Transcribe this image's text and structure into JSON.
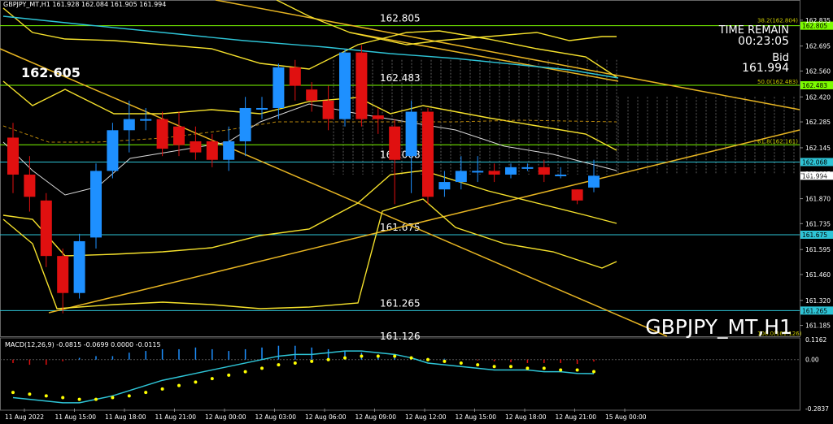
{
  "header": {
    "ohlc": "GBPJPY_MT,H1  161.928 162.084 161.905 161.994"
  },
  "info": {
    "time_remain_label": "TIME REMAIN",
    "time_remain": "00:23:05",
    "bid_label": "Bid",
    "bid": "161.994"
  },
  "symbol_label": "GBPJPY_MT,H1",
  "big_price": "162.605",
  "macd_header": "MACD(12,26,9) -0.0815 -0.0699 0.0000 -0.0115",
  "colors": {
    "bull": "#1e90ff",
    "bear": "#e01010",
    "yellow": "#f5e12c",
    "gold": "#e6b422",
    "cyan": "#2ec4d6",
    "green": "#7cfc00",
    "grid": "#8a8a8a",
    "macd_line": "#2ec4d6",
    "signal": "#ffff00"
  },
  "chart_data": [
    {
      "type": "candlestick",
      "title": "GBPJPY_MT,H1",
      "ylim": [
        161.126,
        162.9
      ],
      "y_ticks": [
        "162.835",
        "162.695",
        "162.560",
        "162.420",
        "162.285",
        "162.145",
        "162.005",
        "161.870",
        "161.735",
        "161.595",
        "161.460",
        "161.320",
        "161.185"
      ],
      "x_ticks": [
        "11 Aug 2022",
        "11 Aug 15:00",
        "11 Aug 18:00",
        "11 Aug 21:00",
        "12 Aug 00:00",
        "12 Aug 03:00",
        "12 Aug 06:00",
        "12 Aug 09:00",
        "12 Aug 12:00",
        "12 Aug 15:00",
        "12 Aug 18:00",
        "12 Aug 21:00",
        "15 Aug 00:00"
      ],
      "candles": [
        {
          "o": 162.2,
          "h": 162.28,
          "c": 162.0,
          "l": 161.9
        },
        {
          "o": 162.0,
          "h": 162.1,
          "c": 161.88,
          "l": 161.8
        },
        {
          "o": 161.86,
          "h": 161.9,
          "c": 161.56,
          "l": 161.5
        },
        {
          "o": 161.56,
          "h": 161.6,
          "c": 161.36,
          "l": 161.25
        },
        {
          "o": 161.36,
          "h": 161.68,
          "c": 161.64,
          "l": 161.33
        },
        {
          "o": 161.66,
          "h": 162.06,
          "c": 162.02,
          "l": 161.6
        },
        {
          "o": 162.02,
          "h": 162.28,
          "c": 162.24,
          "l": 161.98
        },
        {
          "o": 162.24,
          "h": 162.4,
          "c": 162.3,
          "l": 162.12
        },
        {
          "o": 162.3,
          "h": 162.36,
          "c": 162.3,
          "l": 162.24
        },
        {
          "o": 162.3,
          "h": 162.34,
          "c": 162.14,
          "l": 162.1
        },
        {
          "o": 162.26,
          "h": 162.34,
          "c": 162.16,
          "l": 162.1
        },
        {
          "o": 162.18,
          "h": 162.26,
          "c": 162.12,
          "l": 162.08
        },
        {
          "o": 162.18,
          "h": 162.22,
          "c": 162.08,
          "l": 162.04
        },
        {
          "o": 162.08,
          "h": 162.26,
          "c": 162.18,
          "l": 162.02
        },
        {
          "o": 162.18,
          "h": 162.42,
          "c": 162.36,
          "l": 162.1
        },
        {
          "o": 162.36,
          "h": 162.42,
          "c": 162.36,
          "l": 162.3
        },
        {
          "o": 162.36,
          "h": 162.6,
          "c": 162.58,
          "l": 162.3
        },
        {
          "o": 162.58,
          "h": 162.62,
          "c": 162.48,
          "l": 162.4
        },
        {
          "o": 162.46,
          "h": 162.5,
          "c": 162.4,
          "l": 162.34
        },
        {
          "o": 162.4,
          "h": 162.48,
          "c": 162.3,
          "l": 162.24
        },
        {
          "o": 162.3,
          "h": 162.68,
          "c": 162.66,
          "l": 162.26
        },
        {
          "o": 162.66,
          "h": 162.7,
          "c": 162.3,
          "l": 162.26
        },
        {
          "o": 162.32,
          "h": 162.36,
          "c": 162.3,
          "l": 162.22
        },
        {
          "o": 162.26,
          "h": 162.3,
          "c": 162.08,
          "l": 161.84
        },
        {
          "o": 162.1,
          "h": 162.4,
          "c": 162.34,
          "l": 161.9
        },
        {
          "o": 162.34,
          "h": 162.36,
          "c": 161.88,
          "l": 161.84
        },
        {
          "o": 161.92,
          "h": 162.02,
          "c": 161.96,
          "l": 161.88
        },
        {
          "o": 161.96,
          "h": 162.1,
          "c": 162.02,
          "l": 161.92
        },
        {
          "o": 162.02,
          "h": 162.1,
          "c": 162.02,
          "l": 161.96
        },
        {
          "o": 162.02,
          "h": 162.06,
          "c": 162.0,
          "l": 161.96
        },
        {
          "o": 162.0,
          "h": 162.06,
          "c": 162.04,
          "l": 161.98
        },
        {
          "o": 162.04,
          "h": 162.06,
          "c": 162.04,
          "l": 162.02
        },
        {
          "o": 162.04,
          "h": 162.08,
          "c": 162.0,
          "l": 161.96
        },
        {
          "o": 162.0,
          "h": 162.04,
          "c": 162.0,
          "l": 161.98
        },
        {
          "o": 161.92,
          "h": 161.92,
          "c": 161.86,
          "l": 161.84
        },
        {
          "o": 161.93,
          "h": 162.08,
          "c": 161.994,
          "l": 161.905
        }
      ],
      "levels": [
        {
          "value": 162.805,
          "label": "162.805",
          "color": "green",
          "axis_label": "162.805"
        },
        {
          "value": 162.483,
          "label": "162.483",
          "color": "green",
          "axis_label": "162.483",
          "fib": "50.0(162.483)"
        },
        {
          "value": 162.161,
          "label": "",
          "color": "green",
          "axis_label": "",
          "fib": "61.8(162.161)"
        },
        {
          "value": 162.068,
          "label": "162.068",
          "color": "cyan",
          "axis_label": "162.068"
        },
        {
          "value": 161.675,
          "label": "161.675",
          "color": "cyan",
          "axis_label": "161.675"
        },
        {
          "value": 161.265,
          "label": "161.265",
          "color": "cyan",
          "axis_label": "161.265"
        }
      ],
      "fib_top": "38.2(162.804)",
      "fib_bottom": "100.0(161.126)",
      "bottom_level_label": "161.126",
      "current_price": "161.994"
    },
    {
      "type": "bar",
      "title": "MACD(12,26,9)",
      "ylim": [
        -0.2837,
        0.1162
      ],
      "y_ticks": [
        "0.1162",
        "0.00",
        "-0.2837"
      ],
      "histogram": [
        -0.02,
        -0.03,
        -0.03,
        -0.01,
        0.01,
        0.02,
        0.02,
        0.04,
        0.05,
        0.06,
        0.06,
        0.07,
        0.06,
        0.05,
        0.06,
        0.07,
        0.08,
        0.08,
        0.07,
        0.06,
        0.05,
        0.04,
        0.03,
        0.02,
        0.02,
        0.01,
        0.005,
        0.0,
        -0.005,
        -0.01,
        -0.015,
        -0.02,
        -0.02,
        -0.02,
        -0.025,
        -0.0115
      ],
      "macd": [
        -0.22,
        -0.23,
        -0.24,
        -0.25,
        -0.25,
        -0.23,
        -0.21,
        -0.18,
        -0.15,
        -0.12,
        -0.1,
        -0.08,
        -0.06,
        -0.04,
        -0.02,
        0.0,
        0.02,
        0.03,
        0.03,
        0.04,
        0.05,
        0.05,
        0.04,
        0.03,
        0.01,
        -0.02,
        -0.03,
        -0.04,
        -0.05,
        -0.06,
        -0.06,
        -0.06,
        -0.07,
        -0.07,
        -0.08,
        -0.0815
      ],
      "signal": [
        -0.19,
        -0.2,
        -0.21,
        -0.22,
        -0.23,
        -0.23,
        -0.22,
        -0.21,
        -0.19,
        -0.17,
        -0.15,
        -0.13,
        -0.11,
        -0.09,
        -0.07,
        -0.05,
        -0.03,
        -0.02,
        -0.01,
        0.0,
        0.01,
        0.02,
        0.02,
        0.02,
        0.01,
        0.0,
        -0.01,
        -0.02,
        -0.03,
        -0.04,
        -0.04,
        -0.05,
        -0.05,
        -0.06,
        -0.06,
        -0.0699
      ]
    }
  ]
}
